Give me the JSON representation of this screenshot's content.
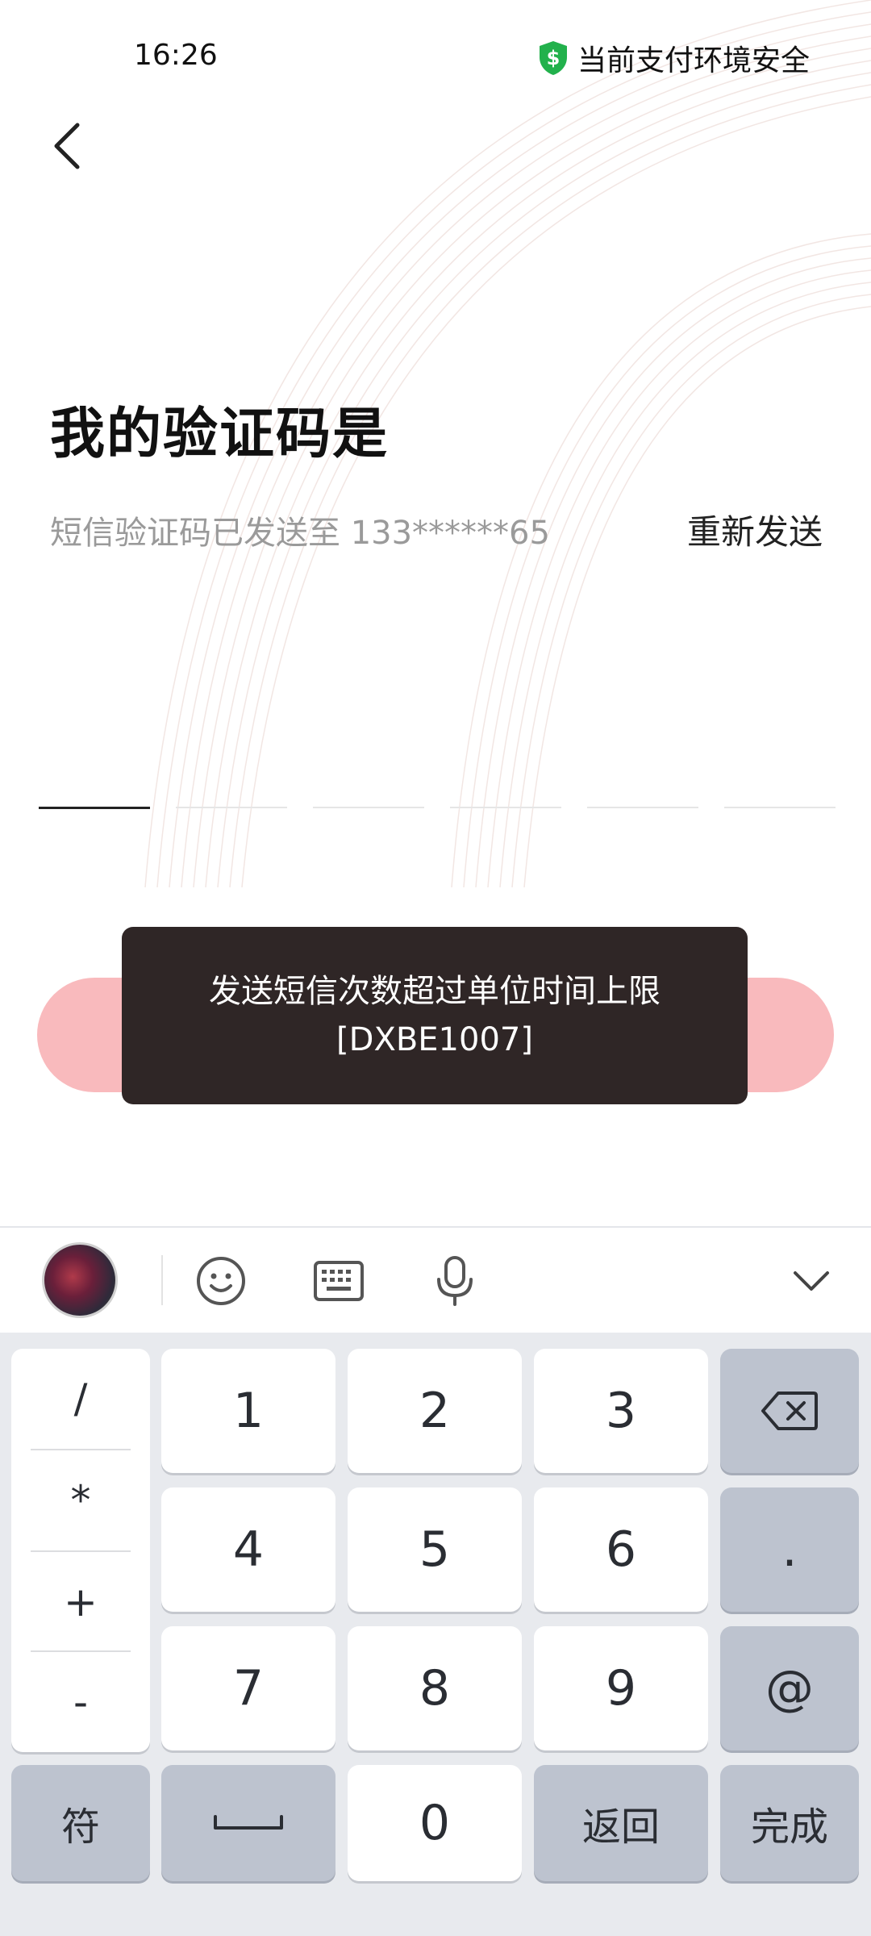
{
  "status_bar": {
    "time": "16:26",
    "security_text": "当前支付环境安全"
  },
  "header": {
    "back_icon": "chevron-left-icon"
  },
  "main": {
    "title": "我的验证码是",
    "sms_hint": "短信验证码已发送至 133******65",
    "resend_label": "重新发送",
    "code_length": 6
  },
  "toast": {
    "line1": "发送短信次数超过单位时间上限",
    "line2": "[DXBE1007]"
  },
  "keyboard_toolbar": {
    "icons": [
      "emoji-icon",
      "keyboard-icon",
      "microphone-icon",
      "chevron-down-icon"
    ]
  },
  "keyboard": {
    "symbols": [
      "/",
      "*",
      "+",
      "-"
    ],
    "digits": [
      "1",
      "2",
      "3",
      "4",
      "5",
      "6",
      "7",
      "8",
      "9",
      "0"
    ],
    "dot": ".",
    "at": "@",
    "symbol_key": "符",
    "back_key": "返回",
    "done_key": "完成"
  },
  "colors": {
    "submit_button": "#f9babd",
    "toast_bg": "#2f2626",
    "shield": "#22b14c"
  }
}
